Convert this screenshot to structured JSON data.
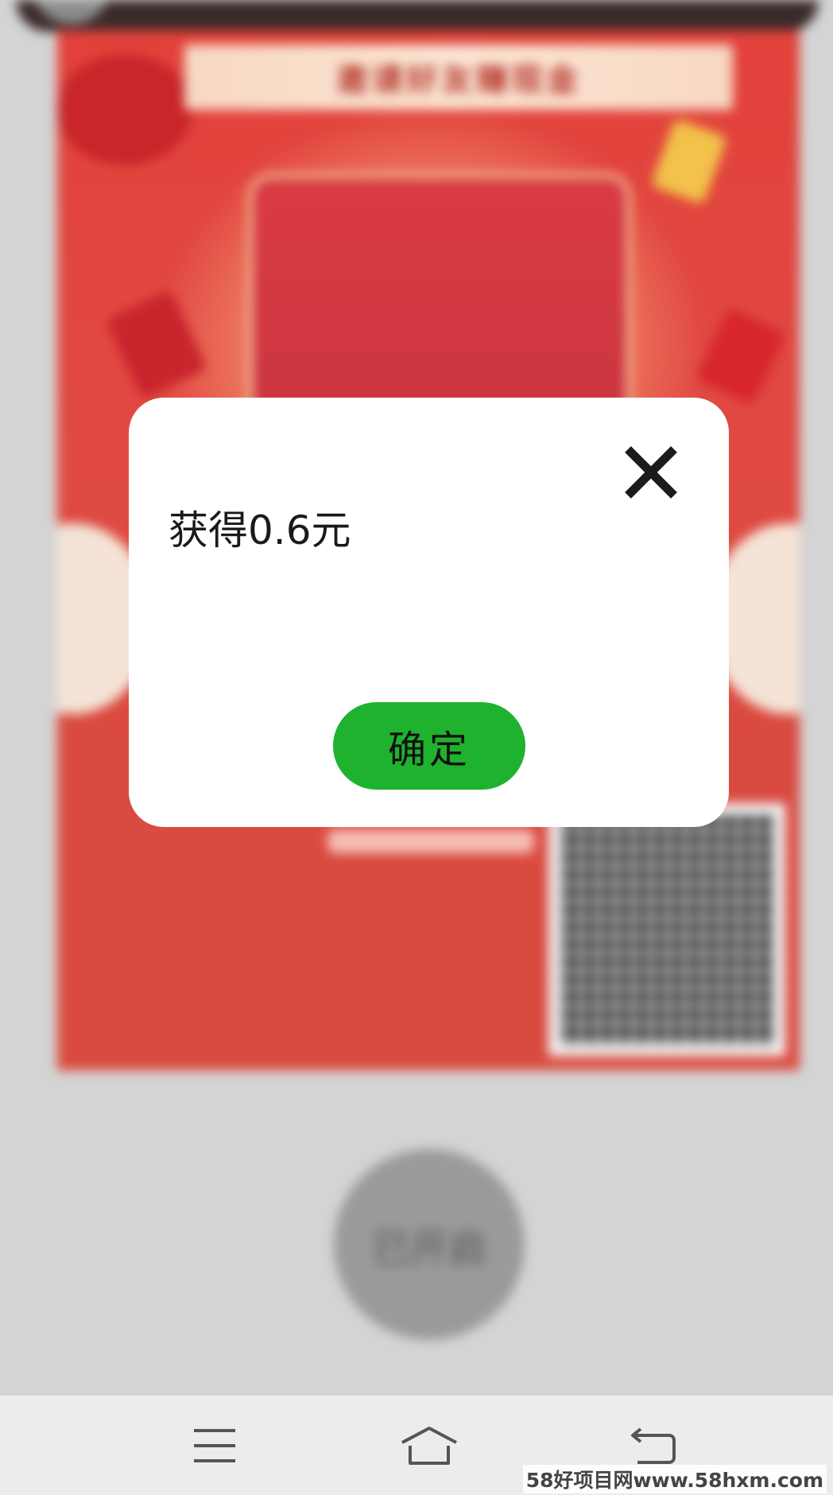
{
  "background": {
    "poster_title": "邀请好友赚现金",
    "open_button_label": "已开启"
  },
  "dialog": {
    "message": "获得0.6元",
    "confirm_label": "确定",
    "close_icon": "close-icon"
  },
  "navbar": {
    "menu_icon": "menu-icon",
    "home_icon": "home-icon",
    "back_icon": "back-icon"
  },
  "watermark": "58好项目网www.58hxm.com",
  "colors": {
    "confirm_button": "#1fb22e",
    "poster_red": "#e2413a",
    "dialog_background": "#ffffff",
    "navbar_background": "#ececec"
  }
}
